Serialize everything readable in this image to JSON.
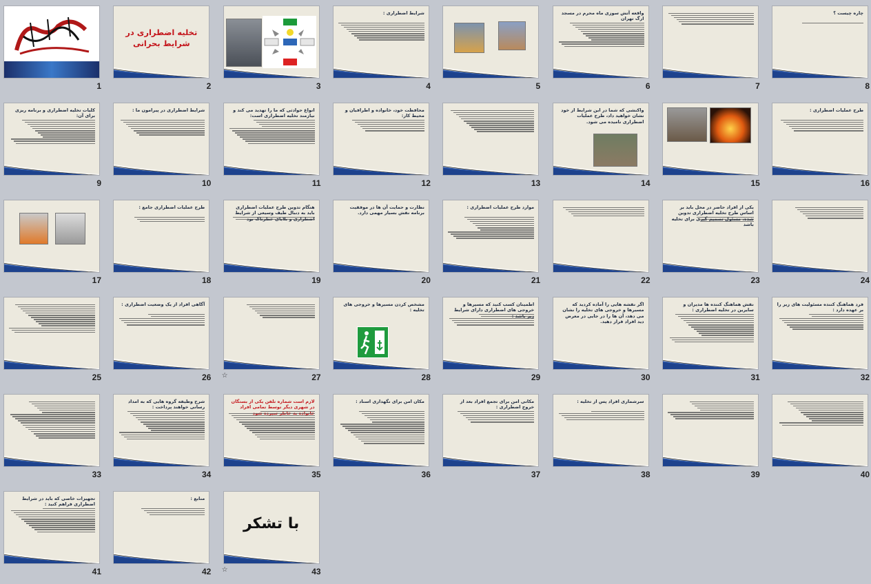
{
  "slides": [
    {
      "n": "1",
      "kind": "calligraphy",
      "title": "",
      "red": false
    },
    {
      "n": "2",
      "kind": "center",
      "title": "تخلیه اضطراری در شرایط بحرانی",
      "red": true
    },
    {
      "n": "3",
      "kind": "diagram",
      "title": "",
      "red": false
    },
    {
      "n": "4",
      "kind": "text",
      "title": "شرایط اضطراری :",
      "red": false,
      "lines": 9
    },
    {
      "n": "5",
      "kind": "photos",
      "title": "",
      "red": false
    },
    {
      "n": "6",
      "kind": "text",
      "title": "واقعه آتش سوزی ماه محرم در مسجد ارگ تهران",
      "red": false,
      "lines": 12
    },
    {
      "n": "7",
      "kind": "text",
      "title": "",
      "red": false,
      "lines": 6
    },
    {
      "n": "8",
      "kind": "text",
      "title": "چاره چیست ؟",
      "red": false,
      "lines": 1
    },
    {
      "n": "9",
      "kind": "text",
      "title": "کلیات تخلیه اضطراری و برنامه ریزی برای آن:",
      "red": false,
      "lines": 12
    },
    {
      "n": "10",
      "kind": "text",
      "title": "شرایط اضطراری در پیرامون ما :",
      "red": false,
      "lines": 8
    },
    {
      "n": "11",
      "kind": "text",
      "title": "انواع حوادثی که ما را تهدید می کند و نیازمند تخلیه اضطراری است:",
      "red": false,
      "lines": 12
    },
    {
      "n": "12",
      "kind": "text",
      "title": "محافظت خود، خانواده و اطرافیان و محیط کار:",
      "red": false,
      "lines": 6
    },
    {
      "n": "13",
      "kind": "text",
      "title": "",
      "red": false,
      "lines": 11
    },
    {
      "n": "14",
      "kind": "photo",
      "title": "واکنشی که شما در این شرایط از خود نشان خواهید داد، طرح عملیات اضطراری نامیده می شود.",
      "red": false
    },
    {
      "n": "15",
      "kind": "photos2",
      "title": "",
      "red": false
    },
    {
      "n": "16",
      "kind": "text",
      "title": "طرح عملیات اضطراری :",
      "red": false,
      "lines": 6
    },
    {
      "n": "17",
      "kind": "photos3",
      "title": "",
      "red": false
    },
    {
      "n": "18",
      "kind": "text",
      "title": "طرح عملیات اضطراری جامع :",
      "red": false,
      "lines": 3
    },
    {
      "n": "19",
      "kind": "text",
      "title": "هنگام تدوین طرح عملیات اضطراری باید به دنبال طیف وسیعی از شرایط اضطراری و بلایای خطرناک بود",
      "red": false,
      "lines": 2
    },
    {
      "n": "20",
      "kind": "text",
      "title": "نظارت و حمایت آن ها در موفقیت برنامه نقش بسیار مهمی دارد.",
      "red": false,
      "lines": 0
    },
    {
      "n": "21",
      "kind": "text",
      "title": "موارد طرح عملیات اضطراری :",
      "red": false,
      "lines": 11
    },
    {
      "n": "22",
      "kind": "text",
      "title": "",
      "red": false,
      "lines": 5
    },
    {
      "n": "23",
      "kind": "text",
      "title": "یکی از افراد حاضر در محل باید بر اساس طرح تخلیه اضطراری تدوین شده، مسئول تصمیم گیری برای تخلیه باشد",
      "red": false,
      "lines": 3
    },
    {
      "n": "24",
      "kind": "text",
      "title": "",
      "red": false,
      "lines": 6
    },
    {
      "n": "25",
      "kind": "text",
      "title": "",
      "red": false,
      "lines": 14
    },
    {
      "n": "26",
      "kind": "text",
      "title": "آگاهی افراد از یک وضعیت اضطراری :",
      "red": false,
      "lines": 6
    },
    {
      "n": "27",
      "kind": "text",
      "title": "",
      "red": false,
      "lines": 7
    },
    {
      "n": "28",
      "kind": "exitsign",
      "title": "مشخص کردن مسیرها و خروجی های تخلیه :",
      "red": false
    },
    {
      "n": "29",
      "kind": "text",
      "title": "اطمینان کسب کنید که مسیرها و خروجی های اضطراری دارای شرایط زیر باشد :",
      "red": false,
      "lines": 6
    },
    {
      "n": "30",
      "kind": "text",
      "title": "اگر نقشه هایی را آماده کردید که مسیرها و خروجی های تخلیه را نشان می دهد، آن ها را در جایی در معرض دید افراد قرار دهید.",
      "red": false,
      "lines": 0
    },
    {
      "n": "31",
      "kind": "text",
      "title": "نقش هماهنگ کننده ها مدیران و سایرین در تخلیه اضطراری :",
      "red": false,
      "lines": 14
    },
    {
      "n": "32",
      "kind": "text",
      "title": "فرد هماهنگ کننده مسئولیت های زیر را بر عهده دارد :",
      "red": false,
      "lines": 8
    },
    {
      "n": "33",
      "kind": "text",
      "title": "",
      "red": false,
      "lines": 18
    },
    {
      "n": "34",
      "kind": "text",
      "title": "شرح وظیفه گروه هایی که به امداد رسانی خواهند پرداخت :",
      "red": false,
      "lines": 14
    },
    {
      "n": "35",
      "kind": "text",
      "title": "لازم است شماره تلفن یکی از بستگان در شهری دیگر توسط تمامی افراد خانواده به خاطر سپرده شود",
      "red": true,
      "lines": 14
    },
    {
      "n": "36",
      "kind": "text",
      "title": "مکان امن برای نگهداری اسناد :",
      "red": false,
      "lines": 16
    },
    {
      "n": "37",
      "kind": "text",
      "title": "مکانی امن برای تجمع افراد بعد از خروج اضطراری :",
      "red": false,
      "lines": 6
    },
    {
      "n": "38",
      "kind": "text",
      "title": "سرشماری افراد پس از تخلیه :",
      "red": false,
      "lines": 5
    },
    {
      "n": "39",
      "kind": "text",
      "title": "",
      "red": false,
      "lines": 9
    },
    {
      "n": "40",
      "kind": "text",
      "title": "",
      "red": false,
      "lines": 12
    },
    {
      "n": "41",
      "kind": "text",
      "title": "تجهیزات خاصی که باید در شرایط اضطراری فراهم کنید :",
      "red": false,
      "lines": 12
    },
    {
      "n": "42",
      "kind": "text",
      "title": "منابع :",
      "red": false,
      "lines": 4
    },
    {
      "n": "43",
      "kind": "thanks",
      "title": "با تشکر",
      "red": false
    }
  ],
  "star_slides": [
    "27",
    "43"
  ],
  "star_icon": "☆",
  "colors": {
    "accent_red": "#c4161c",
    "wave_blue": "#2b56a8",
    "slide_bg": "#ece9de",
    "sorter_bg": "#c3c7cf"
  }
}
